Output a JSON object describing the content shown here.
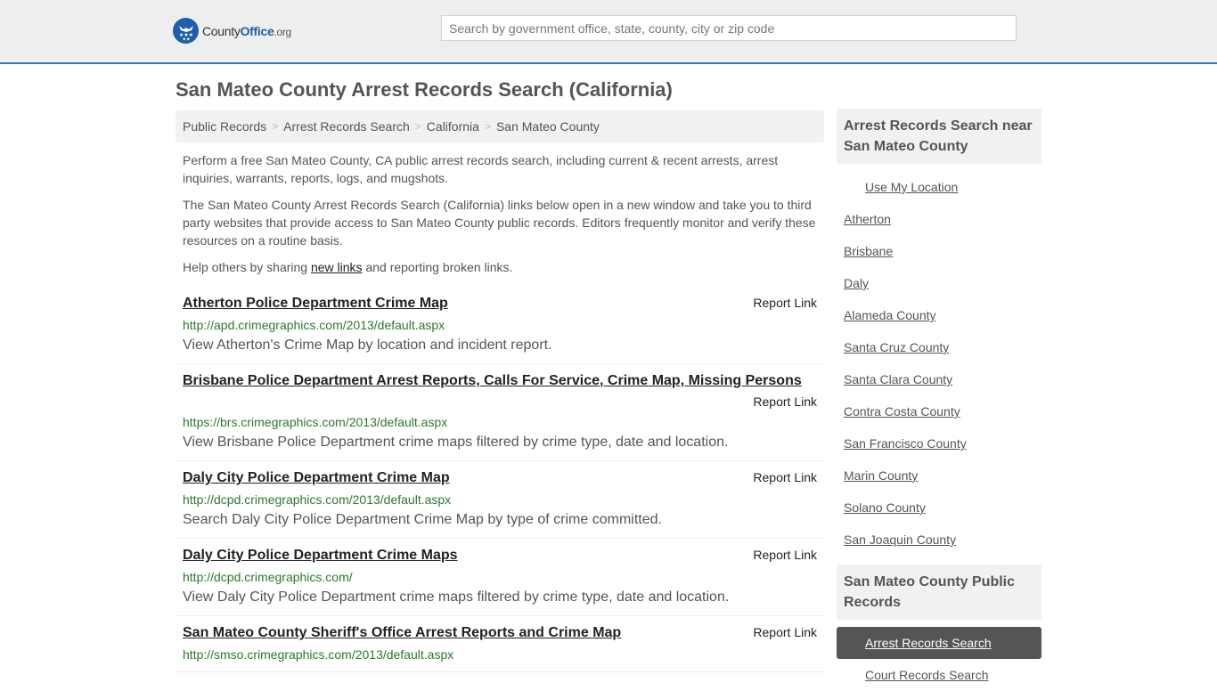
{
  "header": {
    "logo": {
      "name": "County",
      "highlight": "Office",
      "tld": ".org"
    },
    "search_placeholder": "Search by government office, state, county, city or zip code",
    "colors": {
      "brand": "#1f5ea8",
      "accent_bar": "#337ab7"
    }
  },
  "page_title": "San Mateo County Arrest Records Search (California)",
  "breadcrumb": [
    "Public Records",
    "Arrest Records Search",
    "California",
    "San Mateo County"
  ],
  "intro": {
    "p1": "Perform a free San Mateo County, CA public arrest records search, including current & recent arrests, arrest inquiries, warrants, reports, logs, and mugshots.",
    "p2": "The San Mateo County Arrest Records Search (California) links below open in a new window and take you to third party websites that provide access to San Mateo County public records. Editors frequently monitor and verify these resources on a routine basis.",
    "p3_before": "Help others by sharing ",
    "p3_link": "new links",
    "p3_after": " and reporting broken links."
  },
  "listings": [
    {
      "title": "Atherton Police Department Crime Map",
      "url": "http://apd.crimegraphics.com/2013/default.aspx",
      "description": "View Atherton's Crime Map by location and incident report.",
      "report_label": "Report Link"
    },
    {
      "title": "Brisbane Police Department Arrest Reports, Calls For Service, Crime Map, Missing Persons",
      "url": "https://brs.crimegraphics.com/2013/default.aspx",
      "description": "View Brisbane Police Department crime maps filtered by crime type, date and location.",
      "report_label": "Report Link"
    },
    {
      "title": "Daly City Police Department Crime Map",
      "url": "http://dcpd.crimegraphics.com/2013/default.aspx",
      "description": "Search Daly City Police Department Crime Map by type of crime committed.",
      "report_label": "Report Link"
    },
    {
      "title": "Daly City Police Department Crime Maps",
      "url": "http://dcpd.crimegraphics.com/",
      "description": "View Daly City Police Department crime maps filtered by crime type, date and location.",
      "report_label": "Report Link"
    },
    {
      "title": "San Mateo County Sheriff's Office Arrest Reports and Crime Map",
      "url": "http://smso.crimegraphics.com/2013/default.aspx",
      "description": "",
      "report_label": "Report Link"
    }
  ],
  "sidebar": {
    "nearby_heading": "Arrest Records Search near San Mateo County",
    "use_location": "Use My Location",
    "nearby": [
      "Atherton",
      "Brisbane",
      "Daly",
      "Alameda County",
      "Santa Cruz County",
      "Santa Clara County",
      "Contra Costa County",
      "San Francisco County",
      "Marin County",
      "Solano County",
      "San Joaquin County"
    ],
    "records_heading": "San Mateo County Public Records",
    "records": [
      {
        "label": "Arrest Records Search",
        "active": true
      },
      {
        "label": "Court Records Search",
        "active": false
      }
    ]
  }
}
